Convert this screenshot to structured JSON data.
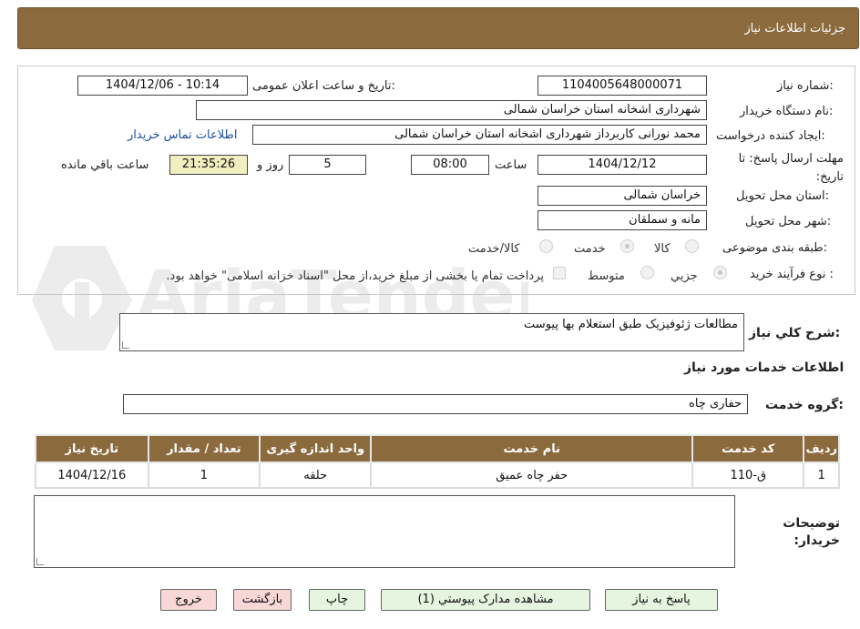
{
  "header": {
    "title": "جزئیات اطلاعات نیاز"
  },
  "form": {
    "need_number_label": "شماره نیاز:",
    "need_number": "1104005648000071",
    "announce_label": "تاریخ و ساعت اعلان عمومی:",
    "announce_value": "1404/12/06 - 10:14",
    "buyer_label": "نام دستگاه خریدار:",
    "buyer_value": "شهرداری اشخانه استان خراسان شمالی",
    "creator_label": "ایجاد کننده درخواست:",
    "creator_value": "محمد نورانی کاربرداز شهرداری اشخانه استان خراسان شمالی",
    "contact_link": "اطلاعات تماس خریدار",
    "deadline_label": "مهلت ارسال پاسخ: تا تاریخ:",
    "deadline_date": "1404/12/12",
    "time_label": "ساعت",
    "deadline_time": "08:00",
    "days_value": "5",
    "days_label": "روز و",
    "remaining_value": "21:35:26",
    "remaining_label": "ساعت باقي مانده",
    "province_label": "استان محل تحویل:",
    "province_value": "خراسان شمالی",
    "city_label": "شهر محل تحویل:",
    "city_value": "مانه و سملقان",
    "category_label": "طبقه بندی موضوعی:",
    "category_options": [
      "کالا",
      "خدمت",
      "کالا/خدمت"
    ],
    "category_selected": "خدمت",
    "process_label": "نوع فرآیند خرید :",
    "process_options": [
      "جزیي",
      "متوسط"
    ],
    "process_selected": "جزیي",
    "payment_note": "پرداخت تمام یا بخشی از مبلغ خرید،از محل \"اسناد خزانه اسلامی\" خواهد بود."
  },
  "description": {
    "label": "شرح کلي نیاز:",
    "value": "مطالعات ژئوفیزیک طبق استعلام بها پیوست"
  },
  "services": {
    "section_title": "اطلاعات خدمات مورد نیاز",
    "group_label": "گروه خدمت:",
    "group_value": "حفاری چاه",
    "columns": [
      "ردیف",
      "کد خدمت",
      "نام خدمت",
      "واحد اندازه گیری",
      "تعداد / مقدار",
      "تاریخ نیاز"
    ],
    "rows": [
      [
        "1",
        "ق-110",
        "حفر چاه عمیق",
        "حلقه",
        "1",
        "1404/12/16"
      ]
    ]
  },
  "buyer_notes": {
    "label": "توضیحات خریدار:",
    "value": ""
  },
  "buttons": {
    "reply": "پاسخ به نیاز",
    "attachments": "مشاهده مدارک پیوستي (1)",
    "print": "چاپ",
    "back": "بازگشت",
    "exit": "خروج"
  },
  "watermark": {
    "text": "AriaTender.neT"
  },
  "colors": {
    "header_bg": "#8b6a3e",
    "highlight": "#f1eec0",
    "link": "#1b4fa0"
  }
}
